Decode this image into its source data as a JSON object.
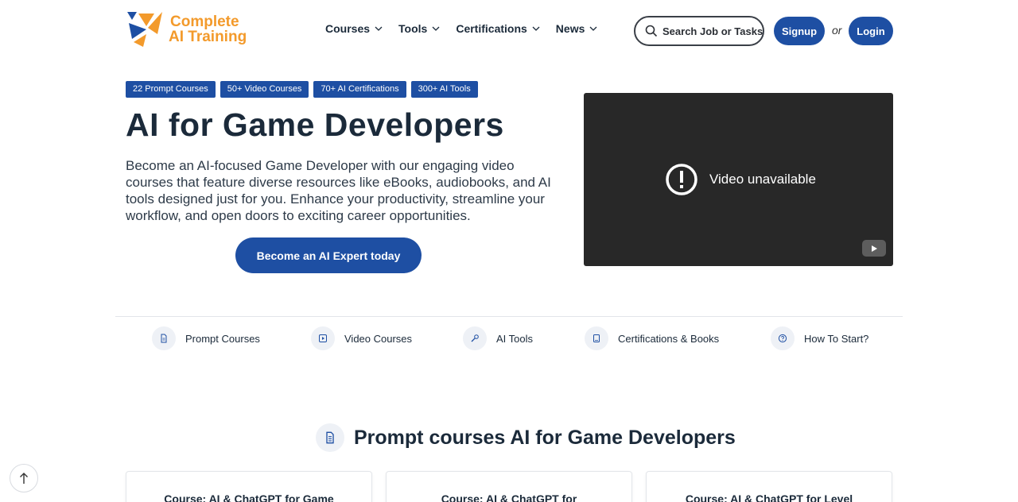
{
  "brand": {
    "line1": "Complete",
    "line2": "AI Training",
    "color": "#f39a2b",
    "accent": "#1e4fa3"
  },
  "nav": {
    "items": [
      {
        "label": "Courses"
      },
      {
        "label": "Tools"
      },
      {
        "label": "Certifications"
      },
      {
        "label": "News"
      }
    ]
  },
  "search": {
    "placeholder": "Search Job or Tasks"
  },
  "auth": {
    "signup": "Signup",
    "or": "or",
    "login": "Login"
  },
  "hero": {
    "tags": [
      "22 Prompt Courses",
      "50+ Video Courses",
      "70+ AI Certifications",
      "300+ AI Tools"
    ],
    "title": "AI for Game Developers",
    "description": "Become an AI-focused Game Developer with our engaging video courses that feature diverse resources like eBooks, audiobooks, and AI tools designed just for you. Enhance your productivity, streamline your workflow, and open doors to exciting career opportunities.",
    "cta": "Become an AI Expert today"
  },
  "video": {
    "message": "Video unavailable"
  },
  "categories": [
    {
      "label": "Prompt Courses",
      "icon": "document-icon"
    },
    {
      "label": "Video Courses",
      "icon": "play-icon"
    },
    {
      "label": "AI Tools",
      "icon": "wrench-icon"
    },
    {
      "label": "Certifications & Books",
      "icon": "book-icon"
    },
    {
      "label": "How To Start?",
      "icon": "question-icon"
    }
  ],
  "section": {
    "title": "Prompt courses AI for Game Developers",
    "cards": [
      {
        "label": "Course: AI & ChatGPT for Game"
      },
      {
        "label": "Course: AI & ChatGPT for"
      },
      {
        "label": "Course: AI & ChatGPT for Level"
      }
    ]
  }
}
